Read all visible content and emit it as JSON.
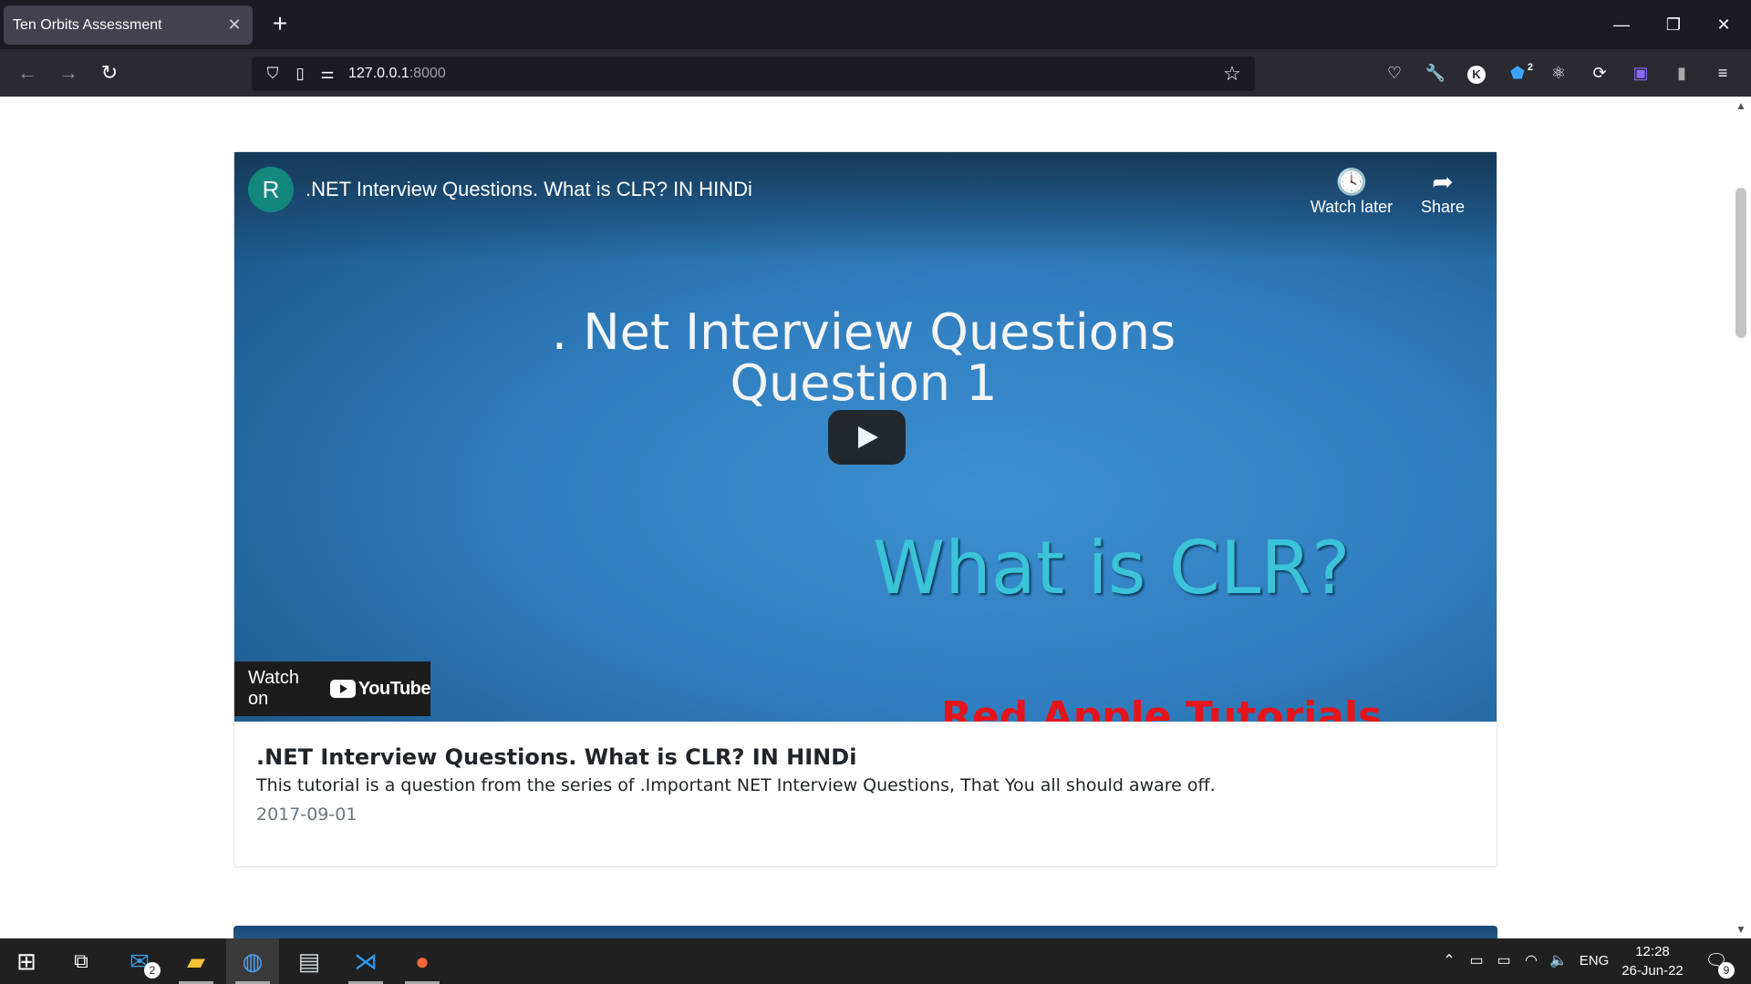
{
  "browser": {
    "tab_title": "Ten Orbits Assessment",
    "tab_close": "✕",
    "new_tab": "+",
    "url_host": "127.0.0.1",
    "url_port": ":8000",
    "extension_badge": "2",
    "k_extension": "K"
  },
  "video": {
    "channel_initial": "R",
    "title": ".NET Interview Questions. What is CLR? IN HINDi",
    "watch_later_label": "Watch later",
    "share_label": "Share",
    "thumbnail_line1": ". Net Interview Questions",
    "thumbnail_line2": "Question 1",
    "thumbnail_clr": "What is CLR?",
    "thumbnail_brand": "Red Apple Tutorials",
    "watch_on_label": "Watch on",
    "youtube_label": "YouTube"
  },
  "card": {
    "title": ".NET Interview Questions. What is CLR? IN HINDi",
    "description": "This tutorial is a question from the series of .Important NET Interview Questions, That You all should aware off.",
    "date": "2017-09-01"
  },
  "taskbar": {
    "mail_badge": "2",
    "language": "ENG",
    "time": "12:28",
    "date": "26-Jun-22",
    "notification_count": "9"
  }
}
